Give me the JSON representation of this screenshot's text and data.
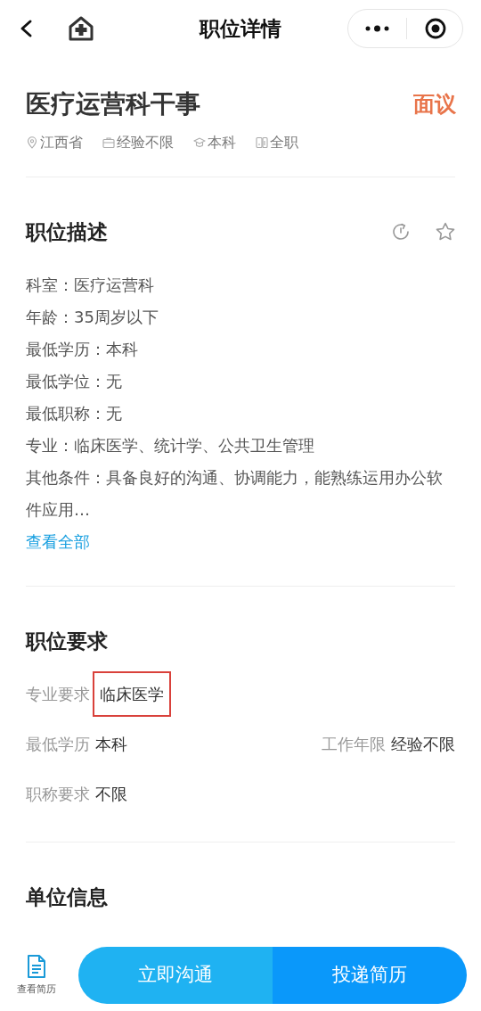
{
  "nav": {
    "title": "职位详情"
  },
  "job": {
    "title": "医疗运营科干事",
    "salary": "面议",
    "tags": [
      {
        "kind": "location",
        "text": "江西省"
      },
      {
        "kind": "experience",
        "text": "经验不限"
      },
      {
        "kind": "education",
        "text": "本科"
      },
      {
        "kind": "type",
        "text": "全职"
      }
    ]
  },
  "description": {
    "title": "职位描述",
    "lines": [
      "科室：医疗运营科",
      "年龄：35周岁以下",
      "最低学历：本科",
      "最低学位：无",
      "最低职称：无",
      "专业：临床医学、统计学、公共卫生管理",
      "其他条件：具备良好的沟通、协调能力，能熟练运用办公软件应用…"
    ],
    "more_link": "查看全部"
  },
  "requirements": {
    "title": "职位要求",
    "rows": [
      [
        {
          "label": "专业要求",
          "value": "临床医学",
          "highlighted": true
        }
      ],
      [
        {
          "label": "最低学历",
          "value": "本科",
          "highlighted": false
        },
        {
          "label": "工作年限",
          "value": "经验不限",
          "highlighted": false
        }
      ],
      [
        {
          "label": "职称要求",
          "value": "不限",
          "highlighted": false
        }
      ]
    ]
  },
  "company": {
    "title": "单位信息"
  },
  "bottom_bar": {
    "resume_label": "查看简历",
    "buttons": [
      "立即沟通",
      "投递简历"
    ]
  }
}
